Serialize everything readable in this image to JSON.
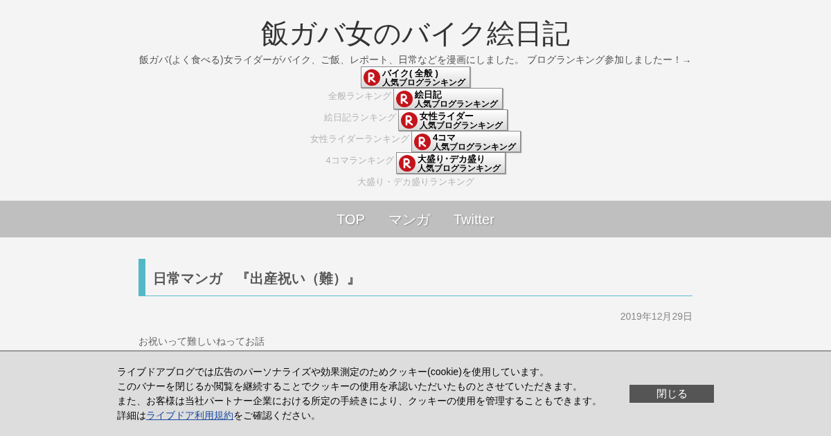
{
  "blog": {
    "title": "飯ガバ女のバイク絵日記",
    "description": "飯ガバ(よく食べる)女ライダーがバイク、ご飯、レポート、日常などを漫画にしました。 ブログランキング参加しましたー！→"
  },
  "ranking_links": [
    {
      "banner_title": "バイク( 全般 )",
      "banner_subtitle": "人気ブログランキング",
      "caption": "全般ランキング"
    },
    {
      "banner_title": "絵日記",
      "banner_subtitle": "人気ブログランキング",
      "caption": "絵日記ランキング"
    },
    {
      "banner_title": "女性ライダー",
      "banner_subtitle": "人気ブログランキング",
      "caption": "女性ライダーランキング"
    },
    {
      "banner_title": "4コマ",
      "banner_subtitle": "人気ブログランキング",
      "caption": "4コマランキング"
    },
    {
      "banner_title": "大盛り･デカ盛り",
      "banner_subtitle": "人気ブログランキング",
      "caption": "大盛り・デカ盛りランキング"
    }
  ],
  "nav": {
    "items": [
      "TOP",
      "マンガ",
      "Twitter"
    ]
  },
  "article": {
    "title": "日常マンガ　『出産祝い（難）』",
    "date": "2019年12月29日",
    "body": "お祝いって難しいねってお話"
  },
  "cookie_banner": {
    "lines": [
      "ライブドアブログでは広告のパーソナライズや効果測定のためクッキー(cookie)を使用しています。",
      "このバナーを閉じるか閲覧を継続することでクッキーの使用を承認いただいたものとさせていただきます。",
      "また、お客様は当社パートナー企業における所定の手続きにより、クッキーの使用を管理することもできます。"
    ],
    "last_line": {
      "before": "詳細は",
      "link": "ライブドア利用規約",
      "after": "をご確認ください。"
    },
    "close_button": "閉じる"
  }
}
